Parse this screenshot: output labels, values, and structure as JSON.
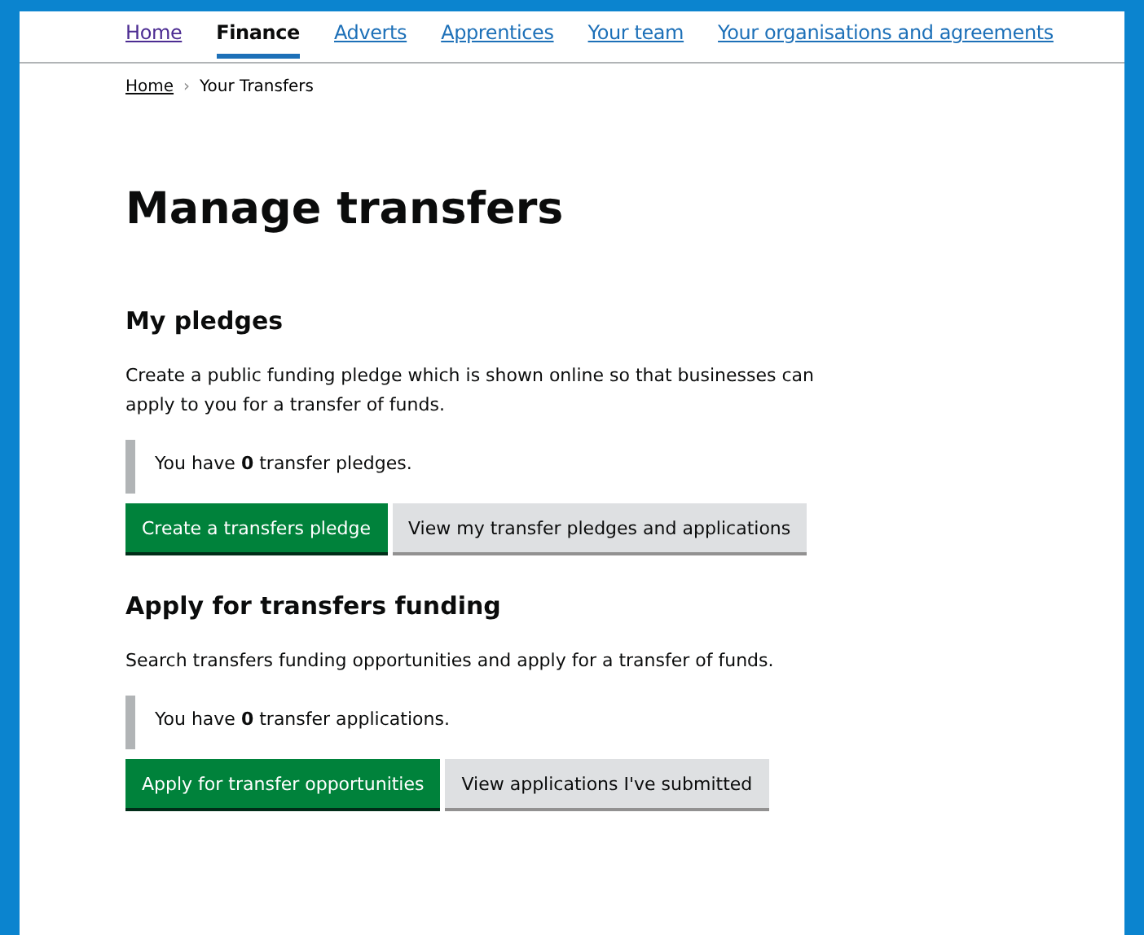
{
  "nav": {
    "items": [
      {
        "label": "Home",
        "selected": false,
        "visited": true
      },
      {
        "label": "Finance",
        "selected": true,
        "visited": false
      },
      {
        "label": "Adverts",
        "selected": false,
        "visited": false
      },
      {
        "label": "Apprentices",
        "selected": false,
        "visited": false
      },
      {
        "label": "Your team",
        "selected": false,
        "visited": false
      },
      {
        "label": "Your organisations and agreements",
        "selected": false,
        "visited": false
      }
    ]
  },
  "breadcrumbs": {
    "link": "Home",
    "separator": "›",
    "current": "Your Transfers"
  },
  "heading": "Manage transfers",
  "sections": [
    {
      "title": "My pledges",
      "body": "Create a public funding pledge which is shown online so that businesses can apply to you for a transfer of funds.",
      "inset": "You have **0** transfer pledges.",
      "buttons": [
        {
          "label": "Create a transfers pledge",
          "kind": "primary"
        },
        {
          "label": "View my transfer pledges and applications",
          "kind": "secondary"
        }
      ]
    },
    {
      "title": "Apply for transfers funding",
      "body": "Search transfers funding opportunities and apply for a transfer of funds.",
      "inset": "You have **0** transfer applications.",
      "buttons": [
        {
          "label": "Apply for transfer opportunities",
          "kind": "primary"
        },
        {
          "label": "View applications I've submitted",
          "kind": "secondary"
        }
      ]
    }
  ]
}
